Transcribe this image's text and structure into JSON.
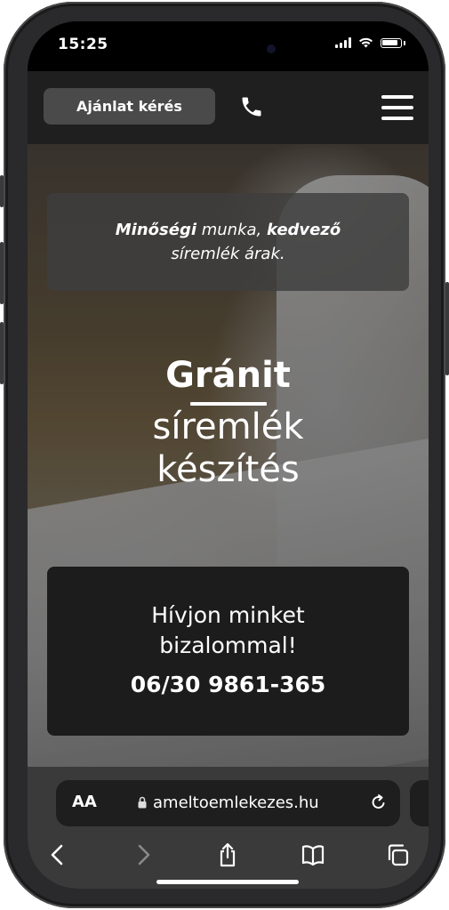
{
  "status_bar": {
    "time": "15:25"
  },
  "navbar": {
    "quote_button": "Ajánlat kérés"
  },
  "hero": {
    "tagline": {
      "bold1": "Minőségi",
      "text1": " munka, ",
      "bold2": "kedvező",
      "line2": "síremlék árak."
    },
    "headline": {
      "line1": "Gránit",
      "line2": "síremlék",
      "line3": "készítés"
    },
    "cta": {
      "line1": "Hívjon minket",
      "line2": "bizalommal!",
      "phone": "06/30 9861-365"
    }
  },
  "browser": {
    "text_size_label": "AA",
    "url": "ameltoemlekezes.hu"
  }
}
